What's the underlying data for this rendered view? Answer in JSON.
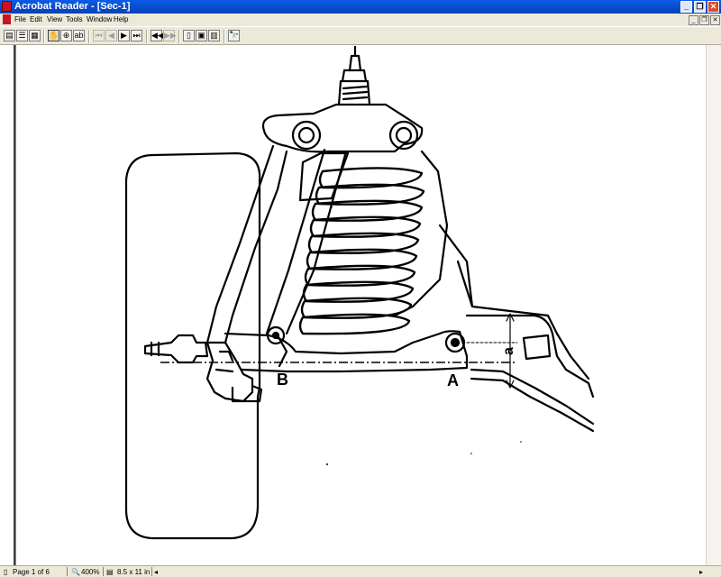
{
  "window": {
    "title": "Acrobat Reader - [Sec-1]"
  },
  "menu": {
    "items": [
      "File",
      "Edit",
      "View",
      "Tools",
      "Window",
      "Help"
    ]
  },
  "toolbar": {
    "tools": [
      "show-navigation-icon",
      "bookmarks-icon",
      "thumbnails-icon",
      "hand-tool-icon",
      "zoom-tool-icon",
      "text-select-icon",
      "first-page-icon",
      "previous-page-icon",
      "next-page-icon",
      "last-page-icon",
      "go-back-icon",
      "go-forward-icon",
      "actual-size-icon",
      "fit-page-icon",
      "fit-width-icon",
      "find-icon"
    ]
  },
  "drawing": {
    "labels": {
      "a": "a",
      "A": "A",
      "B": "B"
    }
  },
  "status": {
    "page": "Page 1 of 6",
    "zoom": "400%",
    "page_size": "8.5 x 11 in"
  }
}
